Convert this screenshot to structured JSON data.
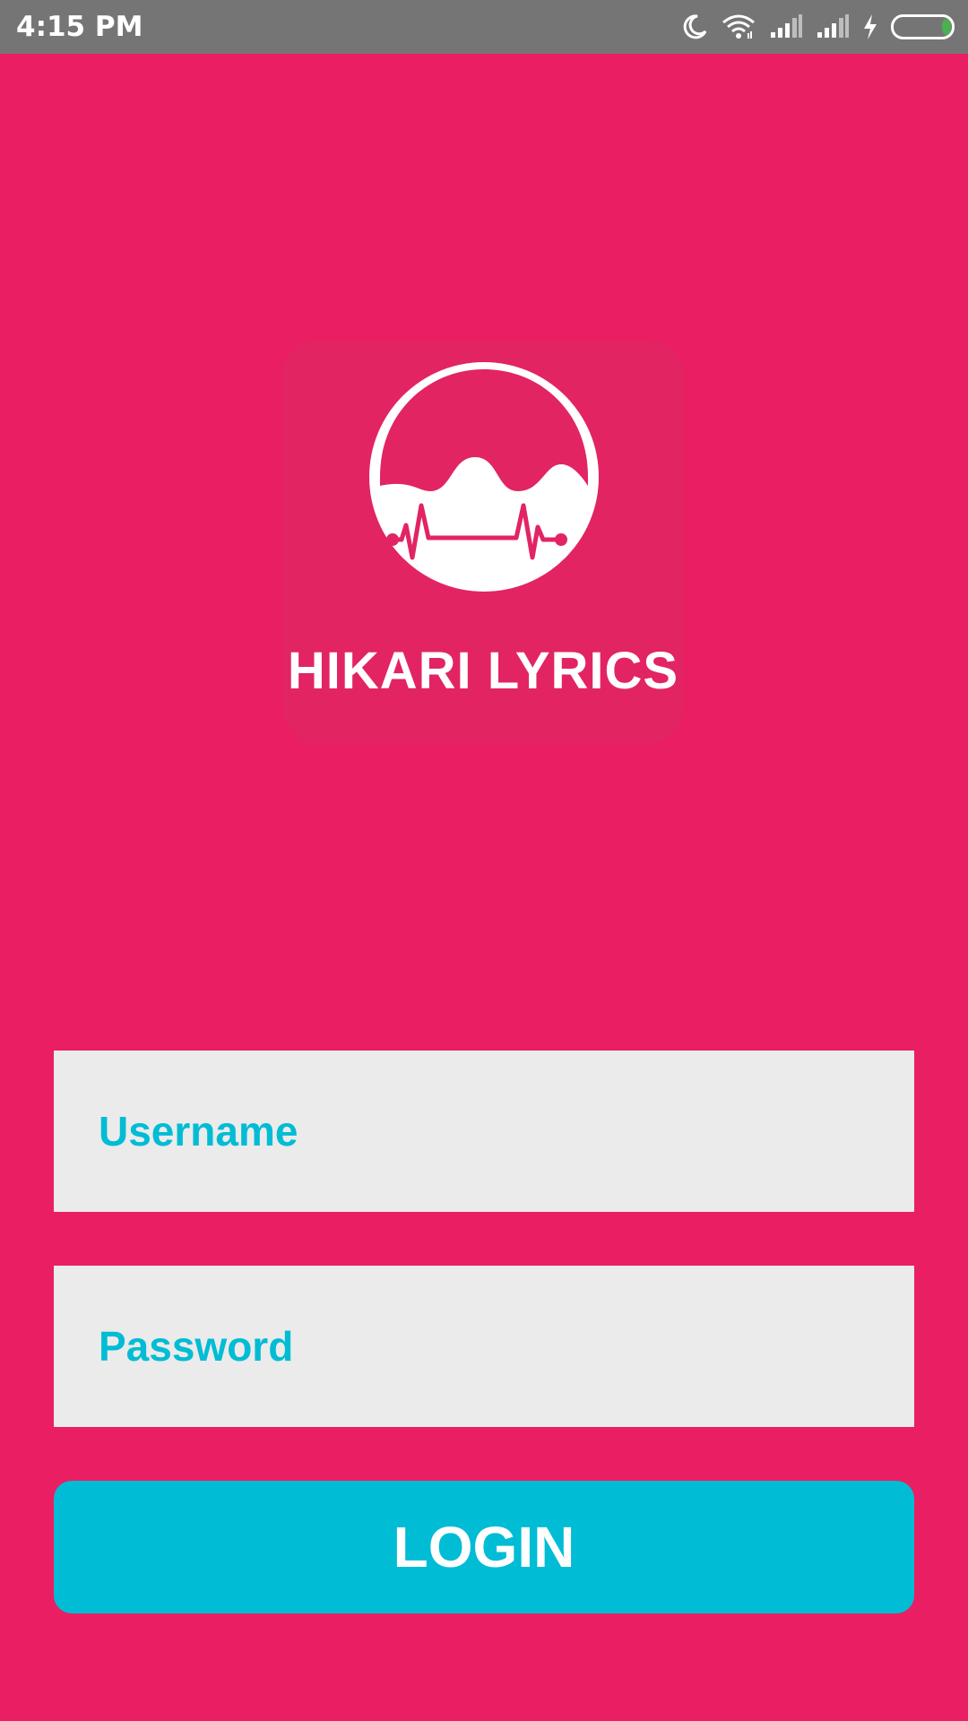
{
  "status_bar": {
    "time": "4:15 PM",
    "icons": [
      "moon-icon",
      "wifi-icon",
      "signal-icon",
      "signal-icon",
      "charging-icon",
      "battery-icon"
    ],
    "battery_level": 0.12
  },
  "app": {
    "title": "HIKARI LYRICS",
    "logo_icon": "hikari-lyrics-logo"
  },
  "login_form": {
    "username_placeholder": "Username",
    "password_placeholder": "Password",
    "login_label": "LOGIN"
  },
  "colors": {
    "background": "#E91E63",
    "accent": "#00BCD4",
    "field_background": "#EBEBEB",
    "status_bar": "#757575"
  }
}
